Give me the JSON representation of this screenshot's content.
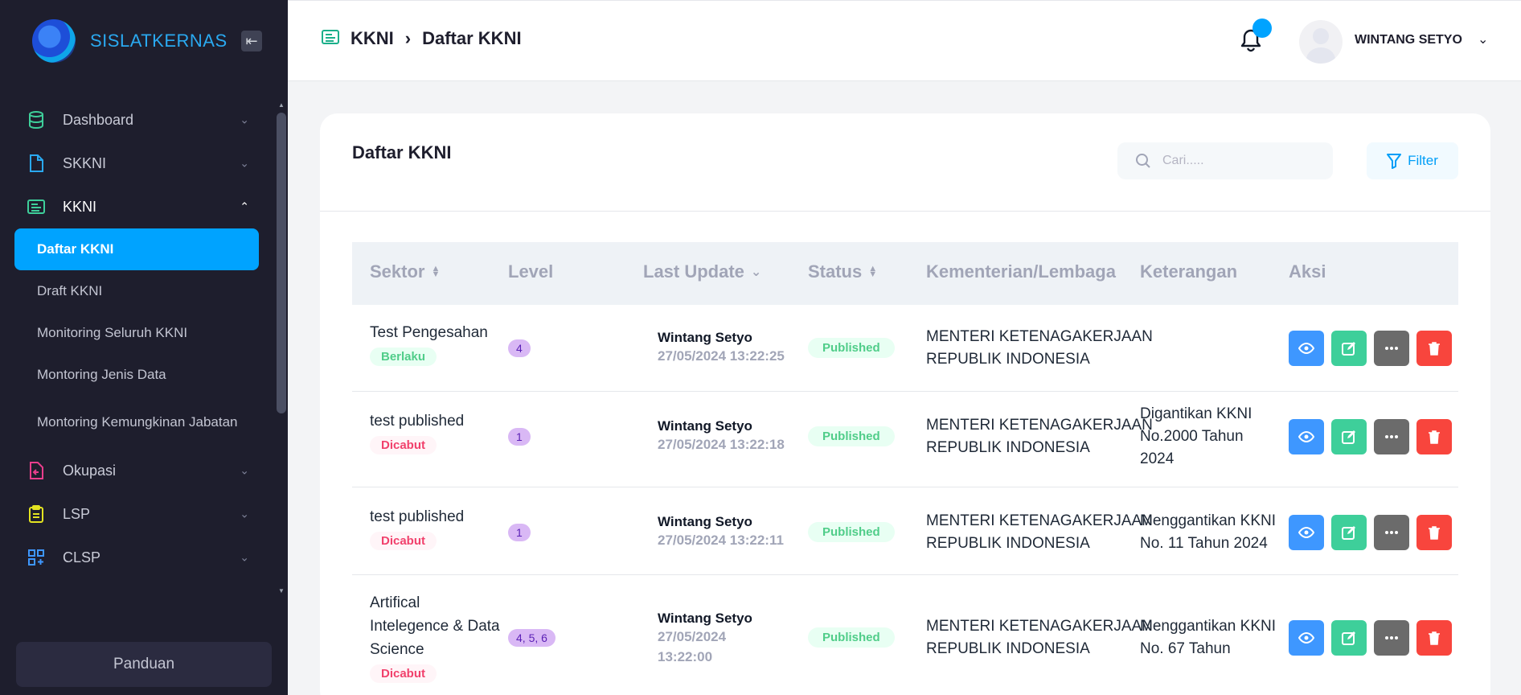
{
  "brand": {
    "name": "SISLATKERNAS"
  },
  "sidebar": {
    "items": [
      {
        "label": "Dashboard"
      },
      {
        "label": "SKKNI"
      },
      {
        "label": "KKNI"
      },
      {
        "label": "Okupasi"
      },
      {
        "label": "LSP"
      },
      {
        "label": "CLSP"
      }
    ],
    "kkni_sub": [
      {
        "label": "Daftar KKNI"
      },
      {
        "label": "Draft KKNI"
      },
      {
        "label": "Monitoring Seluruh KKNI"
      },
      {
        "label": "Montoring Jenis Data"
      },
      {
        "label": "Montoring Kemungkinan Jabatan"
      }
    ],
    "panduan": "Panduan"
  },
  "header": {
    "breadcrumb_root": "KKNI",
    "breadcrumb_current": "Daftar KKNI",
    "username": "WINTANG SETYO"
  },
  "card": {
    "title": "Daftar KKNI",
    "search_placeholder": "Cari.....",
    "filter_label": "Filter"
  },
  "table": {
    "headers": {
      "sektor": "Sektor",
      "level": "Level",
      "last_update": "Last Update",
      "status": "Status",
      "kementerian": "Kementerian/Lembaga",
      "keterangan": "Keterangan",
      "aksi": "Aksi"
    },
    "rows": [
      {
        "sektor_l1": "Test Pengesahan",
        "sektor_l2": "",
        "sektor_l3": "",
        "tag": "Berlaku",
        "level": "4",
        "updater": "Wintang Setyo",
        "date_l1": "27/05/2024 13:22:25",
        "date_l2": "",
        "status": "Published",
        "kl_l1": "MENTERI KETENAGAKERJAAN",
        "kl_l2": "REPUBLIK INDONESIA",
        "ket_l1": "",
        "ket_l2": "",
        "ket_l3": ""
      },
      {
        "sektor_l1": "test published",
        "sektor_l2": "",
        "sektor_l3": "",
        "tag": "Dicabut",
        "level": "1",
        "updater": "Wintang Setyo",
        "date_l1": "27/05/2024 13:22:18",
        "date_l2": "",
        "status": "Published",
        "kl_l1": "MENTERI KETENAGAKERJAAN",
        "kl_l2": "REPUBLIK INDONESIA",
        "ket_l1": "Digantikan KKNI",
        "ket_l2": "No.2000 Tahun",
        "ket_l3": "2024"
      },
      {
        "sektor_l1": "test published",
        "sektor_l2": "",
        "sektor_l3": "",
        "tag": "Dicabut",
        "level": "1",
        "updater": "Wintang Setyo",
        "date_l1": "27/05/2024 13:22:11",
        "date_l2": "",
        "status": "Published",
        "kl_l1": "MENTERI KETENAGAKERJAAN",
        "kl_l2": "REPUBLIK INDONESIA",
        "ket_l1": "Menggantikan KKNI",
        "ket_l2": "No. 11 Tahun 2024",
        "ket_l3": ""
      },
      {
        "sektor_l1": "Artifical",
        "sektor_l2": "Intelegence & Data",
        "sektor_l3": "Science",
        "tag": "Dicabut",
        "level": "4, 5, 6",
        "updater": "Wintang Setyo",
        "date_l1": "27/05/2024",
        "date_l2": "13:22:00",
        "status": "Published",
        "kl_l1": "MENTERI KETENAGAKERJAAN",
        "kl_l2": "REPUBLIK INDONESIA",
        "ket_l1": "Menggantikan KKNI",
        "ket_l2": "No. 67 Tahun",
        "ket_l3": ""
      }
    ]
  },
  "colors": {
    "sidebar_bg": "#1e1e2d",
    "accent": "#00a3ff",
    "brand_text": "#2aa9f0",
    "success": "#50cd89",
    "danger": "#f1416c"
  },
  "icons": {
    "dashboard": "database-icon",
    "skkni": "document-icon",
    "kkni": "ledger-icon",
    "okupasi": "file-export-icon",
    "lsp": "clipboard-icon",
    "clsp": "grid-plus-icon"
  }
}
